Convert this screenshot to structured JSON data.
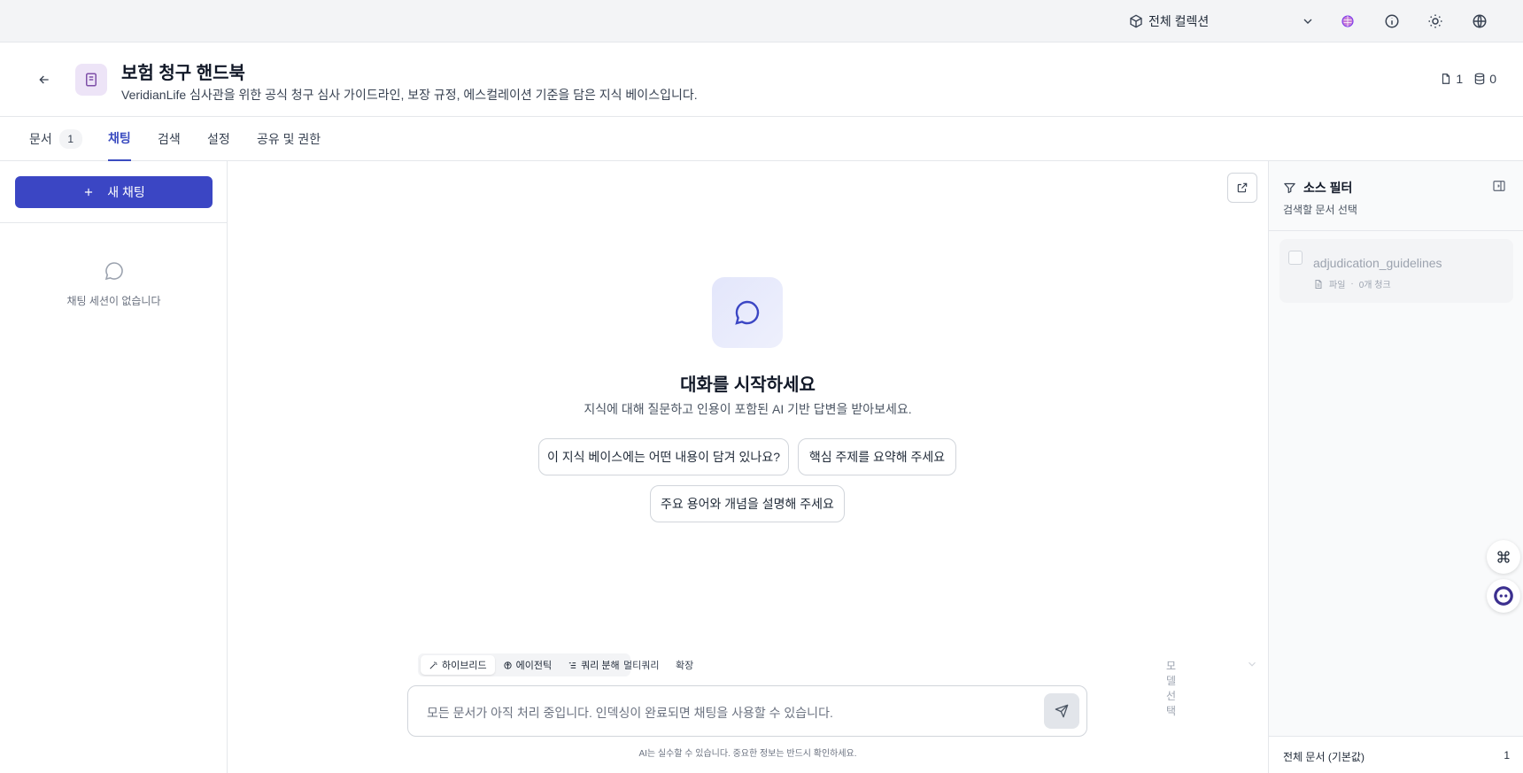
{
  "topbar": {
    "collection_label": "전체 컬렉션"
  },
  "header": {
    "title": "보험 청구 핸드북",
    "description": "VeridianLife 심사관을 위한 공식 청구 심사 가이드라인, 보장 규정, 에스컬레이션 기준을 담은 지식 베이스입니다.",
    "doc_count": "1",
    "db_count": "0"
  },
  "tabs": {
    "docs": "문서",
    "docs_badge": "1",
    "chat": "채팅",
    "search": "검색",
    "settings": "설정",
    "share": "공유 및 권한"
  },
  "sidebar": {
    "new_chat": "새 채팅",
    "empty": "채팅 세션이 없습니다"
  },
  "chat": {
    "title": "대화를 시작하세요",
    "subtitle": "지식에 대해 질문하고 인용이 포함된 AI 기반 답변을 받아보세요.",
    "suggestions": [
      "이 지식 베이스에는 어떤 내용이 담겨 있나요?",
      "핵심 주제를 요약해 주세요",
      "주요 용어와 개념을 설명해 주세요"
    ],
    "modes": [
      "하이브리드",
      "에이전틱",
      "쿼리 분해"
    ],
    "options": [
      "멀티쿼리",
      "확장"
    ],
    "model_placeholder": "모델 선택",
    "input_placeholder": "모든 문서가 아직 처리 중입니다. 인덱싱이 완료되면 채팅을 사용할 수 있습니다.",
    "disclaimer": "AI는 실수할 수 있습니다. 중요한 정보는 반드시 확인하세요."
  },
  "source_filter": {
    "title": "소스 필터",
    "subtitle": "검색할 문서 선택",
    "items": [
      {
        "name": "adjudication_guidelines",
        "type": "파일",
        "sep": "·",
        "chunks": "0개 청크"
      }
    ],
    "footer_label": "전체 문서 (기본값)",
    "footer_count": "1"
  },
  "colors": {
    "accent": "#3b46c4",
    "tab_active": "#3b4cc0"
  }
}
